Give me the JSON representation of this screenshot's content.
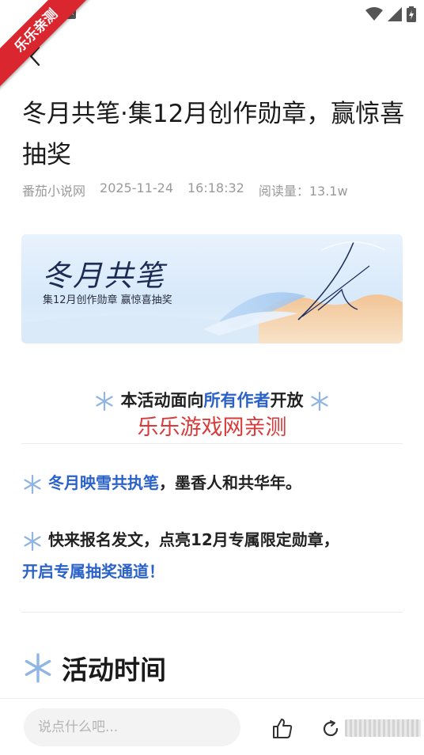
{
  "watermark_ribbon": "乐乐亲测",
  "article": {
    "title": "冬月共笔·集12月创作勋章，赢惊喜抽奖",
    "meta": {
      "source": "番茄小说网",
      "date": "2025-11-24",
      "time": "16:18:32",
      "read_count": "阅读量：13.1w"
    },
    "banner": {
      "title": "冬月共笔",
      "subtitle": "集12月创作勋章 赢惊喜抽奖"
    },
    "notice": {
      "prefix": "本活动面向",
      "highlight": "所有作者",
      "suffix": "开放"
    },
    "watermark_text": "乐乐游戏网亲测",
    "para1": {
      "highlight": "冬月映雪共执笔",
      "text": "，墨香人和共华年。"
    },
    "para2": {
      "text": "快来报名发文，点亮12月专属限定勋章，",
      "highlight": "开启专属抽奖通道！"
    },
    "section_title": "活动时间"
  },
  "bottom_bar": {
    "comment_placeholder": "说点什么吧..."
  },
  "colors": {
    "accent_blue": "#2a62c9",
    "watermark_red": "#d93a3a",
    "ribbon_red": "#d9262f"
  },
  "icons": {
    "back": "chevron-left-icon",
    "like": "thumbs-up-icon",
    "share": "share-icon",
    "snowflake": "snowflake-icon",
    "wifi": "wifi-icon",
    "signal": "signal-icon",
    "battery": "battery-icon"
  }
}
